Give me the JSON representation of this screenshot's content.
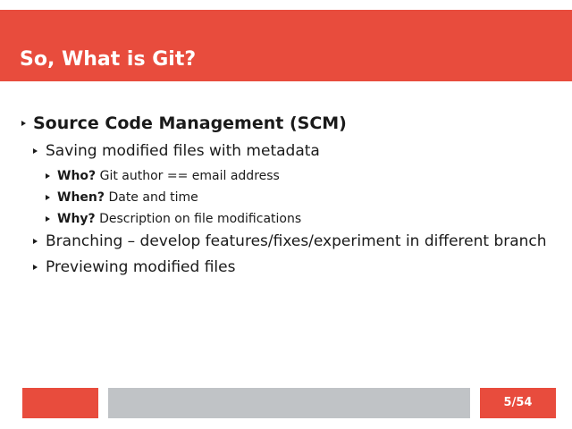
{
  "slide": {
    "title": "So, What is Git?",
    "level1": {
      "text": "Source Code Management (SCM)"
    },
    "saving": {
      "text": "Saving modified files with metadata",
      "details": [
        {
          "label": "Who?",
          "text": "Git author == email address"
        },
        {
          "label": "When?",
          "text": "Date and time"
        },
        {
          "label": "Why?",
          "text": "Description on file modifications"
        }
      ]
    },
    "branching": {
      "text": "Branching – develop features/fixes/experiment in different branch"
    },
    "previewing": {
      "text": "Previewing modified files"
    }
  },
  "footer": {
    "page_number": "5/54"
  },
  "colors": {
    "accent": "#e84c3d",
    "footer_gray": "#c0c3c6",
    "text": "#1a1a1a"
  }
}
